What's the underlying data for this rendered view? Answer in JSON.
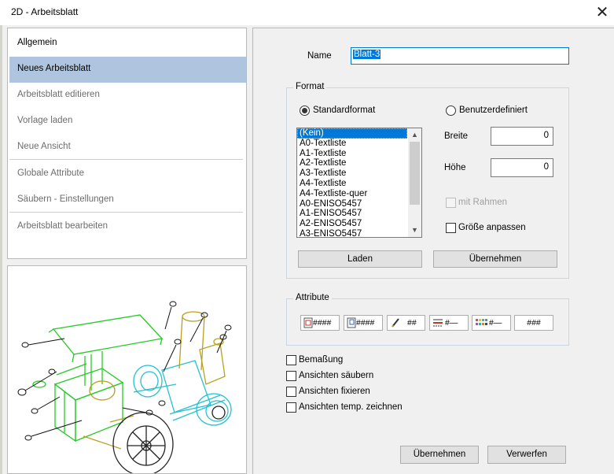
{
  "window": {
    "title": "2D - Arbeitsblatt",
    "close_glyph": "✕"
  },
  "sidebar": {
    "items": [
      {
        "label": "Allgemein",
        "state": "enabled"
      },
      {
        "label": "Neues Arbeitsblatt",
        "state": "selected"
      },
      {
        "label": "Arbeitsblatt editieren",
        "state": "disabled"
      },
      {
        "label": "Vorlage laden",
        "state": "disabled"
      },
      {
        "label": "Neue Ansicht",
        "state": "disabled"
      },
      {
        "label": "Globale Attribute",
        "state": "disabled"
      },
      {
        "label": "Säubern - Einstellungen",
        "state": "disabled"
      },
      {
        "label": "Arbeitsblatt bearbeiten",
        "state": "disabled"
      }
    ]
  },
  "preview": {
    "icon": "machine-drawing-preview"
  },
  "form": {
    "name_label": "Name",
    "name_value": "Blatt-3",
    "format": {
      "group_label": "Format",
      "standard_label": "Standardformat",
      "custom_label": "Benutzerdefiniert",
      "selected": "standard",
      "list": [
        "(Kein)",
        "A0-Textliste",
        "A1-Textliste",
        "A2-Textliste",
        "A3-Textliste",
        "A4-Textliste",
        "A4-Textliste-quer",
        "A0-ENISO5457",
        "A1-ENISO5457",
        "A2-ENISO5457",
        "A3-ENISO5457"
      ],
      "selected_index": 0,
      "width_label": "Breite",
      "width_value": "0",
      "height_label": "Höhe",
      "height_value": "0",
      "frame_label": "mit Rahmen",
      "fit_label": "Größe anpassen",
      "load_button": "Laden",
      "apply_button": "Übernehmen"
    },
    "attributes": {
      "group_label": "Attribute",
      "buttons": [
        {
          "icon": "text-frame-icon",
          "label": "####"
        },
        {
          "icon": "text-frame-alt-icon",
          "label": "####"
        },
        {
          "icon": "pen-icon",
          "label": "##"
        },
        {
          "icon": "line-type-icon",
          "label": "#—"
        },
        {
          "icon": "color-palette-icon",
          "label": "#—"
        },
        {
          "icon": "",
          "label": "###"
        }
      ]
    },
    "options": [
      {
        "label": "Bemaßung",
        "checked": false
      },
      {
        "label": "Ansichten säubern",
        "checked": false
      },
      {
        "label": "Ansichten fixieren",
        "checked": false
      },
      {
        "label": "Ansichten temp. zeichnen",
        "checked": false
      }
    ],
    "ok_button": "Übernehmen",
    "cancel_button": "Verwerfen"
  },
  "colors": {
    "accent": "#0078d7",
    "selection": "#aec4df",
    "drawing_green": "#22cc22",
    "drawing_cyan": "#27c0d0"
  }
}
